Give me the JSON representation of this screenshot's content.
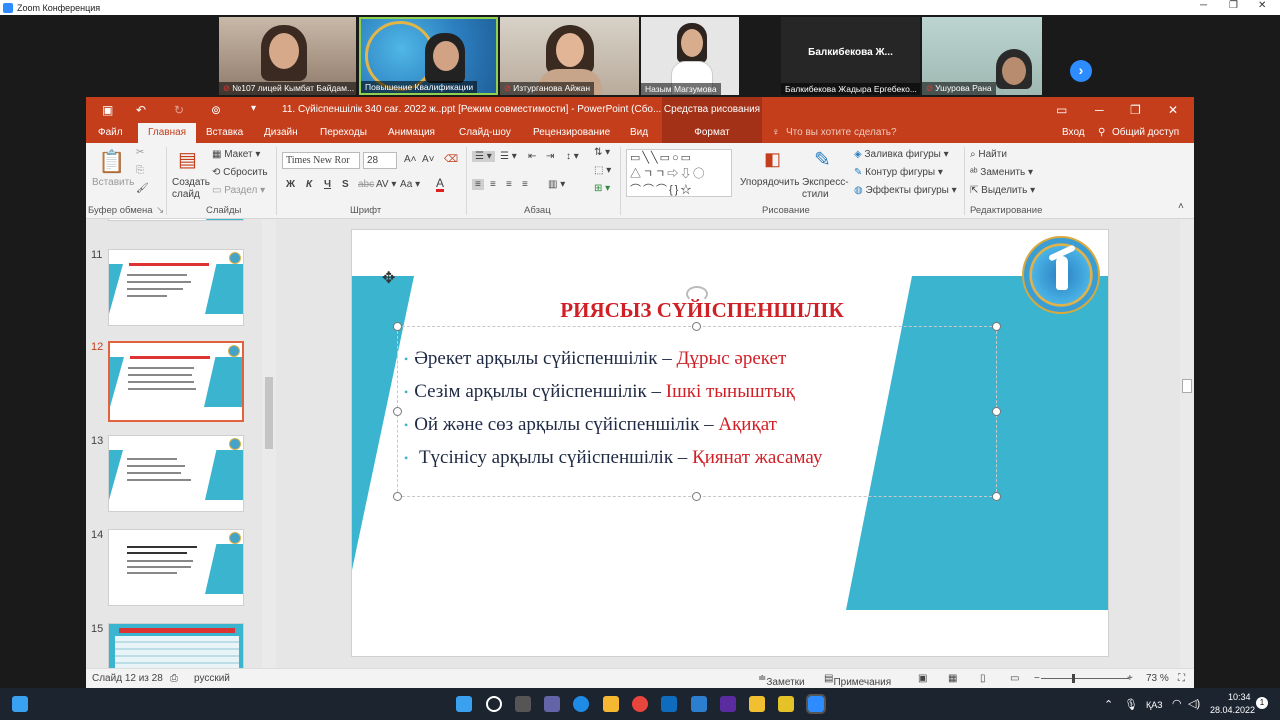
{
  "zoom": {
    "window_title": "Zoom Конференция",
    "participants": [
      {
        "name": "№107 лицей Кымбат Байдам...",
        "muted": true
      },
      {
        "name": "Повышение Квалификации",
        "muted": false
      },
      {
        "name": "Изтурганова Айжан",
        "muted": true
      },
      {
        "name": "Назым Магзумова",
        "muted": false
      },
      {
        "name": "Балкибекова Жадыра Ергебеко...",
        "big_label": "Балкибекова  Ж...",
        "muted": false
      },
      {
        "name": "Ушурова Рана",
        "muted": true
      }
    ],
    "next_symbol": "›"
  },
  "ppt": {
    "doc_title": "11. Сүйіспеншілік 340 сағ. 2022 ж..ppt [Режим совместимости] - PowerPoint (Сбо...",
    "context_group": "Средства рисования",
    "tabs": [
      "Файл",
      "Главная",
      "Вставка",
      "Дизайн",
      "Переходы",
      "Анимация",
      "Слайд-шоу",
      "Рецензирование",
      "Вид",
      "Формат"
    ],
    "active_tab": "Главная",
    "tell_me": "Что вы хотите сделать?",
    "signin": "Вход",
    "share": "Общий доступ",
    "ribbon": {
      "clipboard": {
        "paste": "Вставить",
        "group": "Буфер обмена"
      },
      "slides": {
        "new_slide": "Создать слайд",
        "layout": "Макет",
        "reset": "Сбросить",
        "section": "Раздел",
        "group": "Слайды"
      },
      "font": {
        "name": "Times New Ror",
        "size": "28",
        "bold": "Ж",
        "italic": "К",
        "underline": "Ч",
        "shadow": "S",
        "strike": "abc",
        "spacing": "AV",
        "case": "Аа",
        "color": "А",
        "group": "Шрифт"
      },
      "paragraph": {
        "group": "Абзац"
      },
      "drawing": {
        "arrange": "Упорядочить",
        "quick_styles": "Экспресс-стили",
        "fill": "Заливка фигуры",
        "outline": "Контур фигуры",
        "effects": "Эффекты фигуры",
        "group": "Рисование"
      },
      "editing": {
        "find": "Найти",
        "replace": "Заменить",
        "select": "Выделить",
        "group": "Редактирование"
      }
    },
    "thumbnails": [
      {
        "num": "11",
        "selected": false
      },
      {
        "num": "12",
        "selected": true
      },
      {
        "num": "13",
        "selected": false
      },
      {
        "num": "14",
        "selected": false
      },
      {
        "num": "15",
        "selected": false
      }
    ],
    "slide": {
      "title": "РИЯСЫЗ СҮЙІСПЕНШІЛІК",
      "bullets": [
        {
          "text": "Әрекет арқылы сүйіспеншілік – ",
          "highlight": "Дұрыс әрекет"
        },
        {
          "text": "Сезім арқылы сүйіспеншілік – ",
          "highlight": "Ішкі тыныштық"
        },
        {
          "text": "Ой және сөз арқылы сүйіспеншілік – ",
          "highlight": "Ақиқат"
        },
        {
          "text": " Түсінісу арқылы сүйіспеншілік – ",
          "highlight": "Қиянат жасамау"
        }
      ]
    },
    "status": {
      "slide_of": "Слайд 12 из 28",
      "language": "русский",
      "notes": "Заметки",
      "comments": "Примечания",
      "zoom": "73 %",
      "zoom_fraction": 0.36
    }
  },
  "taskbar": {
    "lang": "ҚАЗ",
    "time": "10:34",
    "date": "28.04.2022",
    "notif": "1"
  },
  "colors": {
    "accent": "#c43e1c",
    "slide_teal": "#3ab4cf",
    "slide_red": "#d11f26"
  }
}
